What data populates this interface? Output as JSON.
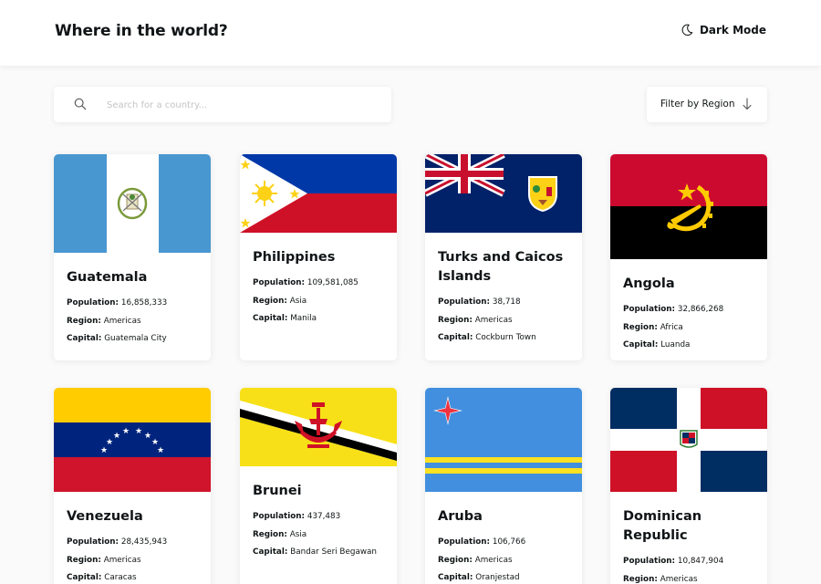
{
  "header": {
    "title": "Where in the world?",
    "mode_label": "Dark Mode",
    "mode_icon": "moon-icon"
  },
  "search": {
    "placeholder": "Search for a country...",
    "value": "",
    "icon": "search-icon"
  },
  "filter": {
    "label": "Filter by Region",
    "icon": "arrow-down-icon"
  },
  "labels": {
    "population": "Population:",
    "region": "Region:",
    "capital": "Capital:"
  },
  "countries": [
    {
      "name": "Guatemala",
      "population": "16,858,333",
      "region": "Americas",
      "capital": "Guatemala City"
    },
    {
      "name": "Philippines",
      "population": "109,581,085",
      "region": "Asia",
      "capital": "Manila"
    },
    {
      "name": "Turks and Caicos Islands",
      "population": "38,718",
      "region": "Americas",
      "capital": "Cockburn Town"
    },
    {
      "name": "Angola",
      "population": "32,866,268",
      "region": "Africa",
      "capital": "Luanda"
    },
    {
      "name": "Venezuela",
      "population": "28,435,943",
      "region": "Americas",
      "capital": "Caracas"
    },
    {
      "name": "Brunei",
      "population": "437,483",
      "region": "Asia",
      "capital": "Bandar Seri Begawan"
    },
    {
      "name": "Aruba",
      "population": "106,766",
      "region": "Americas",
      "capital": "Oranjestad"
    },
    {
      "name": "Dominican Republic",
      "population": "10,847,904",
      "region": "Americas",
      "capital": ""
    }
  ]
}
